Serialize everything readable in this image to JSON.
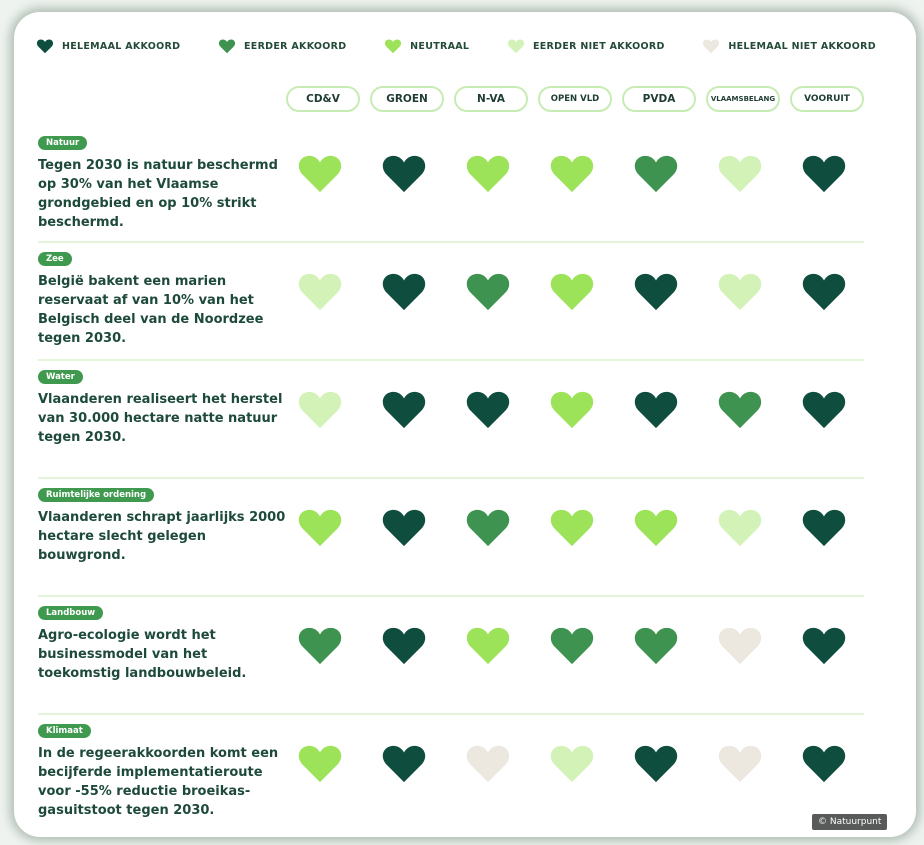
{
  "colors": {
    "helemaal_akkoord": "#0f4d3e",
    "eerder_akkoord": "#3e9350",
    "neutraal": "#9de35a",
    "eerder_niet_akkoord": "#d3f2b8",
    "helemaal_niet_akkoord": "#ece8e0"
  },
  "legend": [
    {
      "label": "HELEMAAL AKKOORD",
      "level": "helemaal_akkoord",
      "icon": "heart-icon"
    },
    {
      "label": "EERDER AKKOORD",
      "level": "eerder_akkoord",
      "icon": "heart-icon"
    },
    {
      "label": "NEUTRAAL",
      "level": "neutraal",
      "icon": "heart-icon"
    },
    {
      "label": "EERDER NIET AKKOORD",
      "level": "eerder_niet_akkoord",
      "icon": "heart-icon"
    },
    {
      "label": "HELEMAAL NIET AKKOORD",
      "level": "helemaal_niet_akkoord",
      "icon": "heart-icon"
    }
  ],
  "parties": [
    {
      "label": "CD&V"
    },
    {
      "label": "GROEN"
    },
    {
      "label": "N-VA"
    },
    {
      "label": "OPEN VLD"
    },
    {
      "label": "PVDA"
    },
    {
      "label": "VLAAMS BELANG"
    },
    {
      "label": "VOORUIT"
    }
  ],
  "statements": [
    {
      "tag": "Natuur",
      "text": "Tegen 2030 is natuur beschermd op 30% van het Vlaamse grondgebied en op 10% strikt beschermd.",
      "ratings": [
        "neutraal",
        "helemaal_akkoord",
        "neutraal",
        "neutraal",
        "eerder_akkoord",
        "eerder_niet_akkoord",
        "helemaal_akkoord"
      ]
    },
    {
      "tag": "Zee",
      "text": "België bakent een marien reservaat af van 10% van het Belgisch deel van de Noordzee tegen 2030.",
      "ratings": [
        "eerder_niet_akkoord",
        "helemaal_akkoord",
        "eerder_akkoord",
        "neutraal",
        "helemaal_akkoord",
        "eerder_niet_akkoord",
        "helemaal_akkoord"
      ]
    },
    {
      "tag": "Water",
      "text": "Vlaanderen realiseert het herstel van 30.000 hectare natte natuur tegen 2030.",
      "ratings": [
        "eerder_niet_akkoord",
        "helemaal_akkoord",
        "helemaal_akkoord",
        "neutraal",
        "helemaal_akkoord",
        "eerder_akkoord",
        "helemaal_akkoord"
      ]
    },
    {
      "tag": "Ruimtelijke ordening",
      "text": "Vlaanderen schrapt jaarlijks 2000 hectare slecht gelegen bouwgrond.",
      "ratings": [
        "neutraal",
        "helemaal_akkoord",
        "eerder_akkoord",
        "neutraal",
        "neutraal",
        "eerder_niet_akkoord",
        "helemaal_akkoord"
      ]
    },
    {
      "tag": "Landbouw",
      "text": "Agro-ecologie wordt het businessmodel van het toekomstig landbouwbeleid.",
      "ratings": [
        "eerder_akkoord",
        "helemaal_akkoord",
        "neutraal",
        "eerder_akkoord",
        "eerder_akkoord",
        "helemaal_niet_akkoord",
        "helemaal_akkoord"
      ]
    },
    {
      "tag": "Klimaat",
      "text": "In de regeerakkoorden komt een becijferde implementatieroute voor -55% reductie broeikas-gasuitstoot tegen 2030.",
      "ratings": [
        "neutraal",
        "helemaal_akkoord",
        "helemaal_niet_akkoord",
        "eerder_niet_akkoord",
        "helemaal_akkoord",
        "helemaal_niet_akkoord",
        "helemaal_akkoord"
      ]
    }
  ],
  "credit": "© Natuurpunt"
}
